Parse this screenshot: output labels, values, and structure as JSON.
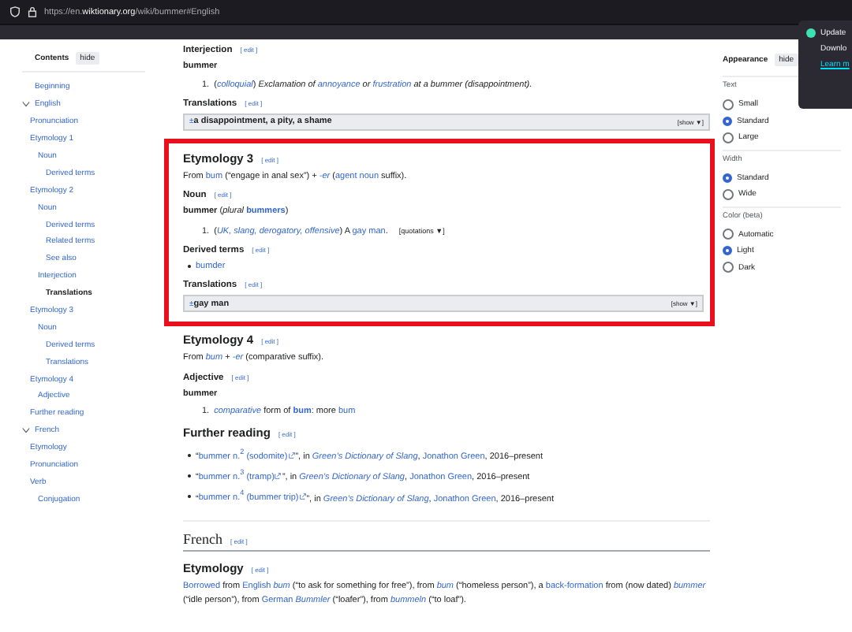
{
  "browser": {
    "url_start": "https://en.",
    "url_domain": "wiktionary.org",
    "url_end": "/wiki/bummer#English"
  },
  "notification": {
    "title": "Update",
    "text": "Downlo",
    "link": "Learn m"
  },
  "toc": {
    "title": "Contents",
    "hide": "hide",
    "items": [
      {
        "label": "Beginning",
        "selected": false
      },
      {
        "label": "English",
        "selected": false,
        "expanded": true,
        "children": [
          {
            "label": "Pronunciation",
            "selected": false
          },
          {
            "label": "Etymology 1",
            "selected": false,
            "children": [
              {
                "label": "Noun",
                "selected": false,
                "children": [
                  {
                    "label": "Derived terms",
                    "selected": false
                  }
                ]
              }
            ]
          },
          {
            "label": "Etymology 2",
            "selected": false,
            "children": [
              {
                "label": "Noun",
                "selected": false,
                "children": [
                  {
                    "label": "Derived terms",
                    "selected": false
                  },
                  {
                    "label": "Related terms",
                    "selected": false
                  },
                  {
                    "label": "See also",
                    "selected": false
                  }
                ]
              },
              {
                "label": "Interjection",
                "selected": false,
                "children": [
                  {
                    "label": "Translations",
                    "selected": true
                  }
                ]
              }
            ]
          },
          {
            "label": "Etymology 3",
            "selected": false,
            "children": [
              {
                "label": "Noun",
                "selected": false,
                "children": [
                  {
                    "label": "Derived terms",
                    "selected": false
                  },
                  {
                    "label": "Translations",
                    "selected": false
                  }
                ]
              }
            ]
          },
          {
            "label": "Etymology 4",
            "selected": false,
            "children": [
              {
                "label": "Adjective",
                "selected": false
              }
            ]
          },
          {
            "label": "Further reading",
            "selected": false
          }
        ]
      },
      {
        "label": "French",
        "selected": false,
        "expanded": true,
        "children": [
          {
            "label": "Etymology",
            "selected": false
          },
          {
            "label": "Pronunciation",
            "selected": false
          },
          {
            "label": "Verb",
            "selected": false,
            "children": [
              {
                "label": "Conjugation",
                "selected": false
              }
            ]
          }
        ]
      }
    ]
  },
  "content": [
    {
      "highlighted": false,
      "blocks": [
        {
          "kind": "h4",
          "text": "Interjection",
          "edit": "[ edit ]"
        },
        {
          "kind": "headword",
          "segs": [
            {
              "t": "bummer",
              "kind": "bold"
            }
          ]
        },
        {
          "kind": "definitions",
          "items": [
            {
              "num": "1.",
              "segs": [
                {
                  "t": "(",
                  "kind": "plain"
                },
                {
                  "t": "colloquial",
                  "kind": "italic-link"
                },
                {
                  "t": ") ",
                  "kind": "plain"
                },
                {
                  "t": "Exclamation of ",
                  "kind": "italic"
                },
                {
                  "t": "annoyance",
                  "kind": "italic-link"
                },
                {
                  "t": " or ",
                  "kind": "italic"
                },
                {
                  "t": "frustration",
                  "kind": "italic-link"
                },
                {
                  "t": " at a bummer (disappointment).",
                  "kind": "italic"
                }
              ]
            }
          ]
        },
        {
          "kind": "h5",
          "text": "Translations",
          "edit": "[ edit ]"
        },
        {
          "kind": "translations",
          "toggle": "±",
          "gloss": "a disappointment, a pity, a shame",
          "show": "[show ▼]"
        }
      ]
    },
    {
      "highlighted": true,
      "blocks": [
        {
          "kind": "h3",
          "text": "Etymology 3",
          "edit": "[ edit ]"
        },
        {
          "kind": "paragraph",
          "segs": [
            {
              "t": "From ",
              "kind": "plain"
            },
            {
              "t": "bum",
              "kind": "link"
            },
            {
              "t": " (“engage in anal sex”) + ",
              "kind": "plain"
            },
            {
              "t": "-er",
              "kind": "italic-link"
            },
            {
              "t": " (",
              "kind": "plain"
            },
            {
              "t": "agent noun",
              "kind": "link"
            },
            {
              "t": " suffix).",
              "kind": "plain"
            }
          ]
        },
        {
          "kind": "h4",
          "text": "Noun",
          "edit": "[ edit ]"
        },
        {
          "kind": "headword",
          "segs": [
            {
              "t": "bummer",
              "kind": "bold"
            },
            {
              "t": " (",
              "kind": "plain"
            },
            {
              "t": "plural ",
              "kind": "italic"
            },
            {
              "t": "bummers",
              "kind": "bold-link"
            },
            {
              "t": ")",
              "kind": "plain"
            }
          ]
        },
        {
          "kind": "definitions",
          "items": [
            {
              "num": "1.",
              "segs": [
                {
                  "t": "(",
                  "kind": "plain"
                },
                {
                  "t": "UK, slang, derogatory, offensive",
                  "kind": "italic-link"
                },
                {
                  "t": ") A ",
                  "kind": "plain"
                },
                {
                  "t": "gay man",
                  "kind": "link"
                },
                {
                  "t": ".",
                  "kind": "plain"
                }
              ],
              "extra": "[quotations ▼]"
            }
          ]
        },
        {
          "kind": "h5",
          "text": "Derived terms",
          "edit": "[ edit ]"
        },
        {
          "kind": "bullets",
          "items": [
            {
              "segs": [
                {
                  "t": "bumder",
                  "kind": "link"
                }
              ]
            }
          ]
        },
        {
          "kind": "h5",
          "text": "Translations",
          "edit": "[ edit ]"
        },
        {
          "kind": "translations",
          "toggle": "±",
          "gloss": "gay man",
          "show": "[show ▼]"
        }
      ]
    },
    {
      "highlighted": false,
      "blocks": [
        {
          "kind": "h3",
          "text": "Etymology 4",
          "edit": "[ edit ]"
        },
        {
          "kind": "paragraph",
          "segs": [
            {
              "t": "From ",
              "kind": "plain"
            },
            {
              "t": "bum",
              "kind": "italic-link"
            },
            {
              "t": " + ",
              "kind": "plain"
            },
            {
              "t": "-er",
              "kind": "italic-link"
            },
            {
              "t": " (comparative suffix).",
              "kind": "plain"
            }
          ]
        },
        {
          "kind": "h4",
          "text": "Adjective",
          "edit": "[ edit ]"
        },
        {
          "kind": "headword",
          "segs": [
            {
              "t": "bummer",
              "kind": "bold"
            }
          ]
        },
        {
          "kind": "definitions",
          "items": [
            {
              "num": "1.",
              "segs": [
                {
                  "t": "comparative",
                  "kind": "italic-link"
                },
                {
                  "t": " form of ",
                  "kind": "plain"
                },
                {
                  "t": "bum",
                  "kind": "bold-link"
                },
                {
                  "t": ": more ",
                  "kind": "plain"
                },
                {
                  "t": "bum",
                  "kind": "link"
                }
              ]
            }
          ]
        },
        {
          "kind": "h3",
          "text": "Further reading",
          "edit": "[ edit ]"
        },
        {
          "kind": "bullets",
          "items": [
            {
              "segs": [
                {
                  "t": "“",
                  "kind": "plain"
                },
                {
                  "t": "bummer n.$^{2}$ (sodomite)",
                  "kind": "link"
                },
                {
                  "kind": "ext"
                },
                {
                  "t": "”, in ",
                  "kind": "plain"
                },
                {
                  "t": "Green’s Dictionary of Slang",
                  "kind": "italic-link"
                },
                {
                  "t": ", ",
                  "kind": "plain"
                },
                {
                  "t": "Jonathon Green",
                  "kind": "link"
                },
                {
                  "t": ", 2016–present",
                  "kind": "plain"
                }
              ]
            },
            {
              "segs": [
                {
                  "t": "“",
                  "kind": "plain"
                },
                {
                  "t": "bummer n.$^{3}$ (tramp)",
                  "kind": "link"
                },
                {
                  "kind": "ext"
                },
                {
                  "t": "”, in ",
                  "kind": "plain"
                },
                {
                  "t": "Green’s Dictionary of Slang",
                  "kind": "italic-link"
                },
                {
                  "t": ", ",
                  "kind": "plain"
                },
                {
                  "t": "Jonathon Green",
                  "kind": "link"
                },
                {
                  "t": ", 2016–present",
                  "kind": "plain"
                }
              ]
            },
            {
              "segs": [
                {
                  "t": "“",
                  "kind": "plain"
                },
                {
                  "t": "bummer n.$^{4}$ (bummer trip)",
                  "kind": "link"
                },
                {
                  "kind": "ext"
                },
                {
                  "t": "”, in ",
                  "kind": "plain"
                },
                {
                  "t": "Green’s Dictionary of Slang",
                  "kind": "italic-link"
                },
                {
                  "t": ", ",
                  "kind": "plain"
                },
                {
                  "t": "Jonathon Green",
                  "kind": "link"
                },
                {
                  "t": ", 2016–present",
                  "kind": "plain"
                }
              ]
            }
          ]
        },
        {
          "kind": "h2",
          "text": "French",
          "edit": "[ edit ]"
        },
        {
          "kind": "h3",
          "text": "Etymology",
          "edit": "[ edit ]"
        },
        {
          "kind": "paragraph",
          "segs": [
            {
              "t": "Borrowed",
              "kind": "link"
            },
            {
              "t": " from ",
              "kind": "plain"
            },
            {
              "t": "English ",
              "kind": "link"
            },
            {
              "t": "bum",
              "kind": "italic-link"
            },
            {
              "t": " (“to ask for something for free”), from ",
              "kind": "plain"
            },
            {
              "t": "bum",
              "kind": "italic-link"
            },
            {
              "t": " (“homeless person”), a ",
              "kind": "plain"
            },
            {
              "t": "back-formation",
              "kind": "link"
            },
            {
              "t": " from (now dated) ",
              "kind": "plain"
            },
            {
              "t": "bummer",
              "kind": "italic-link"
            },
            {
              "t": " (“idle person”), from ",
              "kind": "plain"
            },
            {
              "t": "German ",
              "kind": "link"
            },
            {
              "t": "Bummler",
              "kind": "italic-link"
            },
            {
              "t": " (“loafer”), from ",
              "kind": "plain"
            },
            {
              "t": "bummeln",
              "kind": "italic-link"
            },
            {
              "t": " (“to loaf”).",
              "kind": "plain"
            }
          ]
        }
      ]
    }
  ],
  "appearance": {
    "title": "Appearance",
    "hide": "hide",
    "groups": [
      {
        "label": "Text",
        "options": [
          {
            "label": "Small",
            "selected": false
          },
          {
            "label": "Standard",
            "selected": true
          },
          {
            "label": "Large",
            "selected": false
          }
        ]
      },
      {
        "label": "Width",
        "options": [
          {
            "label": "Standard",
            "selected": true
          },
          {
            "label": "Wide",
            "selected": false
          }
        ]
      },
      {
        "label": "Color (beta)",
        "options": [
          {
            "label": "Automatic",
            "selected": false
          },
          {
            "label": "Light",
            "selected": true
          },
          {
            "label": "Dark",
            "selected": false
          }
        ]
      }
    ]
  }
}
